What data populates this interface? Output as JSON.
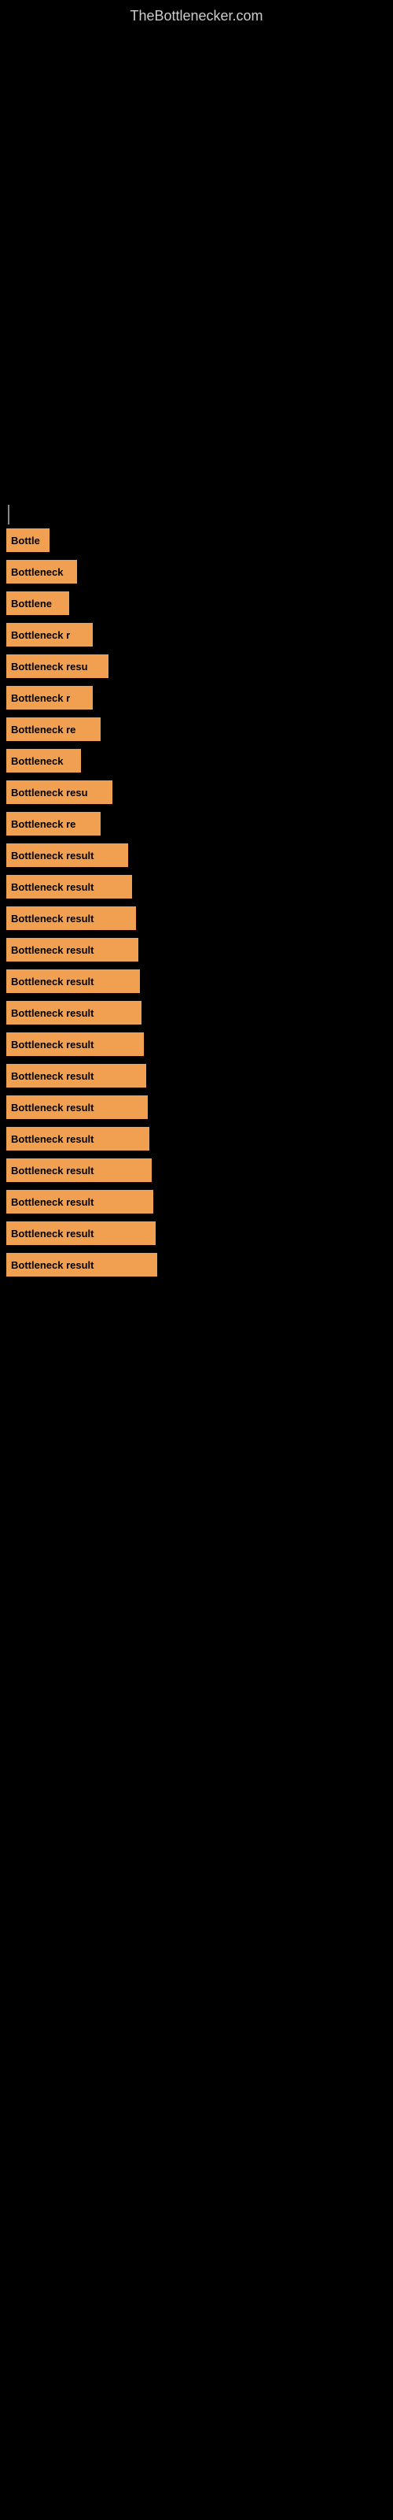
{
  "site": {
    "title": "TheBottlenecker.com"
  },
  "bars": [
    {
      "label": "Bottle",
      "width": 55
    },
    {
      "label": "Bottleneck",
      "width": 90
    },
    {
      "label": "Bottlene",
      "width": 80
    },
    {
      "label": "Bottleneck r",
      "width": 110
    },
    {
      "label": "Bottleneck resu",
      "width": 130
    },
    {
      "label": "Bottleneck r",
      "width": 110
    },
    {
      "label": "Bottleneck re",
      "width": 120
    },
    {
      "label": "Bottleneck",
      "width": 95
    },
    {
      "label": "Bottleneck resu",
      "width": 135
    },
    {
      "label": "Bottleneck re",
      "width": 120
    },
    {
      "label": "Bottleneck result",
      "width": 155
    },
    {
      "label": "Bottleneck result",
      "width": 160
    },
    {
      "label": "Bottleneck result",
      "width": 165
    },
    {
      "label": "Bottleneck result",
      "width": 168
    },
    {
      "label": "Bottleneck result",
      "width": 170
    },
    {
      "label": "Bottleneck result",
      "width": 172
    },
    {
      "label": "Bottleneck result",
      "width": 175
    },
    {
      "label": "Bottleneck result",
      "width": 178
    },
    {
      "label": "Bottleneck result",
      "width": 180
    },
    {
      "label": "Bottleneck result",
      "width": 182
    },
    {
      "label": "Bottleneck result",
      "width": 185
    },
    {
      "label": "Bottleneck result",
      "width": 187
    },
    {
      "label": "Bottleneck result",
      "width": 190
    },
    {
      "label": "Bottleneck result",
      "width": 192
    }
  ]
}
